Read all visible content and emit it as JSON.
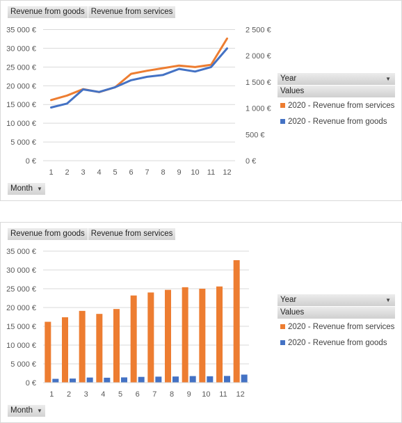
{
  "colors": {
    "services": "#ED7D31",
    "goods": "#4472C4",
    "grid": "#d9d9d9",
    "text": "#595959"
  },
  "field_buttons": [
    "Revenue from goods",
    "Revenue from services"
  ],
  "axis_field_button": {
    "label": "Month",
    "icon": "dropdown-caret"
  },
  "legend": {
    "header": "Year",
    "header_icon": "dropdown-caret",
    "subheader": "Values",
    "items": [
      {
        "label": "2020 - Revenue from services",
        "color": "#ED7D31"
      },
      {
        "label": "2020 - Revenue from goods",
        "color": "#4472C4"
      }
    ]
  },
  "chart_data": [
    {
      "type": "line",
      "title": "",
      "xlabel": "",
      "ylabel": "",
      "categories": [
        "1",
        "2",
        "3",
        "4",
        "5",
        "6",
        "7",
        "8",
        "9",
        "10",
        "11",
        "12"
      ],
      "y_primary": {
        "ticks": [
          "0 €",
          "5 000 €",
          "10 000 €",
          "15 000 €",
          "20 000 €",
          "25 000 €",
          "30 000 €",
          "35 000 €"
        ],
        "range": [
          0,
          35000
        ]
      },
      "y_secondary": {
        "ticks": [
          "0 €",
          "500 €",
          "1 000 €",
          "1 500 €",
          "2 000 €",
          "2 500 €"
        ],
        "range": [
          0,
          2500
        ]
      },
      "grid": true,
      "legend": "right",
      "series": [
        {
          "name": "2020 - Revenue from services",
          "axis": "primary",
          "values": [
            16200,
            17400,
            19100,
            18300,
            19600,
            23200,
            24000,
            24700,
            25400,
            25000,
            25600,
            32600
          ]
        },
        {
          "name": "2020 - Revenue from goods",
          "axis": "secondary",
          "values": [
            1015,
            1090,
            1360,
            1310,
            1400,
            1535,
            1600,
            1635,
            1750,
            1700,
            1785,
            2140
          ]
        }
      ]
    },
    {
      "type": "bar",
      "title": "",
      "xlabel": "",
      "ylabel": "",
      "categories": [
        "1",
        "2",
        "3",
        "4",
        "5",
        "6",
        "7",
        "8",
        "9",
        "10",
        "11",
        "12"
      ],
      "y_primary": {
        "ticks": [
          "0 €",
          "5 000 €",
          "10 000 €",
          "15 000 €",
          "20 000 €",
          "25 000 €",
          "30 000 €",
          "35 000 €"
        ],
        "range": [
          0,
          35000
        ]
      },
      "grid": true,
      "legend": "right",
      "series": [
        {
          "name": "2020 - Revenue from services",
          "values": [
            16200,
            17400,
            19100,
            18300,
            19600,
            23200,
            24000,
            24700,
            25400,
            25000,
            25600,
            32600
          ]
        },
        {
          "name": "2020 - Revenue from goods",
          "values": [
            1015,
            1090,
            1360,
            1310,
            1400,
            1535,
            1600,
            1635,
            1750,
            1700,
            1785,
            2140
          ]
        }
      ]
    }
  ]
}
